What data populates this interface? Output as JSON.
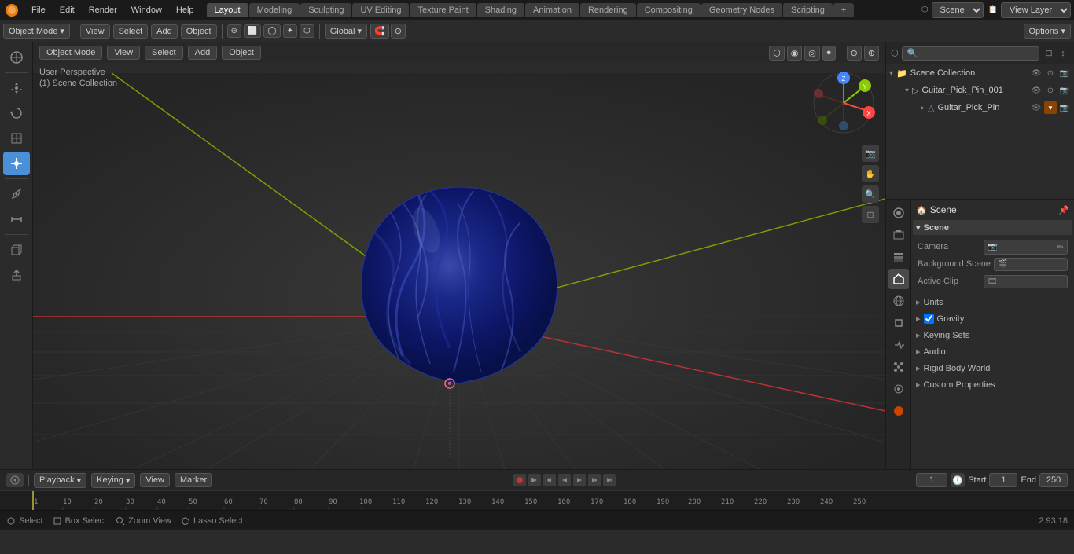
{
  "app": {
    "version": "2.93.18"
  },
  "top_menu": {
    "logo_char": "🔵",
    "items": [
      "File",
      "Edit",
      "Render",
      "Window",
      "Help"
    ],
    "workspace_tabs": [
      {
        "label": "Layout",
        "active": true
      },
      {
        "label": "Modeling",
        "active": false
      },
      {
        "label": "Sculpting",
        "active": false
      },
      {
        "label": "UV Editing",
        "active": false
      },
      {
        "label": "Texture Paint",
        "active": false
      },
      {
        "label": "Shading",
        "active": false
      },
      {
        "label": "Animation",
        "active": false
      },
      {
        "label": "Rendering",
        "active": false
      },
      {
        "label": "Compositing",
        "active": false
      },
      {
        "label": "Geometry Nodes",
        "active": false
      },
      {
        "label": "Scripting",
        "active": false
      },
      {
        "label": "+",
        "active": false
      }
    ],
    "scene": "Scene",
    "view_layer": "View Layer"
  },
  "second_toolbar": {
    "object_mode_label": "Object Mode",
    "view_label": "View",
    "select_label": "Select",
    "add_label": "Add",
    "object_label": "Object",
    "transform_label": "Global",
    "options_label": "Options ▾"
  },
  "viewport": {
    "perspective_label": "User Perspective",
    "collection_label": "(1) Scene Collection"
  },
  "left_tools": [
    {
      "icon": "↖",
      "name": "cursor-tool",
      "active": false
    },
    {
      "icon": "✥",
      "name": "move-tool",
      "active": false
    },
    {
      "icon": "↺",
      "name": "rotate-tool",
      "active": false
    },
    {
      "icon": "⊡",
      "name": "scale-tool",
      "active": false
    },
    {
      "icon": "⊞",
      "name": "transform-tool",
      "active": true
    },
    {
      "icon": "⊙",
      "name": "annotate-tool",
      "active": false
    },
    {
      "icon": "✏",
      "name": "measure-tool",
      "active": false
    },
    {
      "icon": "⬡",
      "name": "add-cube-tool",
      "active": false
    },
    {
      "icon": "☊",
      "name": "extrude-tool",
      "active": false
    }
  ],
  "outliner": {
    "search_placeholder": "🔍",
    "items": [
      {
        "label": "Scene Collection",
        "icon": "📁",
        "indent": 0,
        "expanded": true,
        "id": "scene-collection"
      },
      {
        "label": "Guitar_Pick_Pin_001",
        "icon": "▷",
        "indent": 1,
        "expanded": true,
        "id": "guitar-pick-pin-001"
      },
      {
        "label": "Guitar_Pick_Pin",
        "icon": "△",
        "indent": 2,
        "expanded": false,
        "id": "guitar-pick-pin"
      }
    ]
  },
  "properties": {
    "active_tab": "scene",
    "tabs": [
      {
        "icon": "🔧",
        "name": "render-tab"
      },
      {
        "icon": "📷",
        "name": "output-tab"
      },
      {
        "icon": "🎬",
        "name": "view-layer-tab"
      },
      {
        "icon": "🌐",
        "name": "scene-tab",
        "active": true
      },
      {
        "icon": "🌍",
        "name": "world-tab"
      },
      {
        "icon": "⬛",
        "name": "object-tab"
      },
      {
        "icon": "◻",
        "name": "modifiers-tab"
      },
      {
        "icon": "⚡",
        "name": "particles-tab"
      },
      {
        "icon": "🔴",
        "name": "material-tab"
      }
    ],
    "section_scene": {
      "label": "Scene",
      "camera_label": "Camera",
      "camera_value": "",
      "background_scene_label": "Background Scene",
      "active_clip_label": "Active Clip"
    },
    "section_units": {
      "label": "Units"
    },
    "section_gravity": {
      "label": "Gravity",
      "checked": true
    },
    "section_keying_sets": {
      "label": "Keying Sets"
    },
    "section_audio": {
      "label": "Audio"
    },
    "section_rigid_body_world": {
      "label": "Rigid Body World"
    },
    "section_custom_properties": {
      "label": "Custom Properties"
    }
  },
  "timeline": {
    "playback_label": "Playback",
    "keying_label": "Keying",
    "view_label": "View",
    "marker_label": "Marker",
    "frame_current": "1",
    "start_label": "Start",
    "start_value": "1",
    "end_label": "End",
    "end_value": "250",
    "tick_marks": [
      "1",
      "50",
      "100",
      "150",
      "200",
      "250"
    ],
    "ruler_numbers": [
      1,
      10,
      20,
      30,
      40,
      50,
      60,
      70,
      80,
      90,
      100,
      110,
      120,
      130,
      140,
      150,
      160,
      170,
      180,
      190,
      200,
      210,
      220,
      230,
      240,
      250
    ]
  },
  "status_bar": {
    "select_label": "Select",
    "box_select_label": "Box Select",
    "zoom_view_label": "Zoom View",
    "lasso_select_label": "Lasso Select",
    "version": "2.93.18"
  }
}
